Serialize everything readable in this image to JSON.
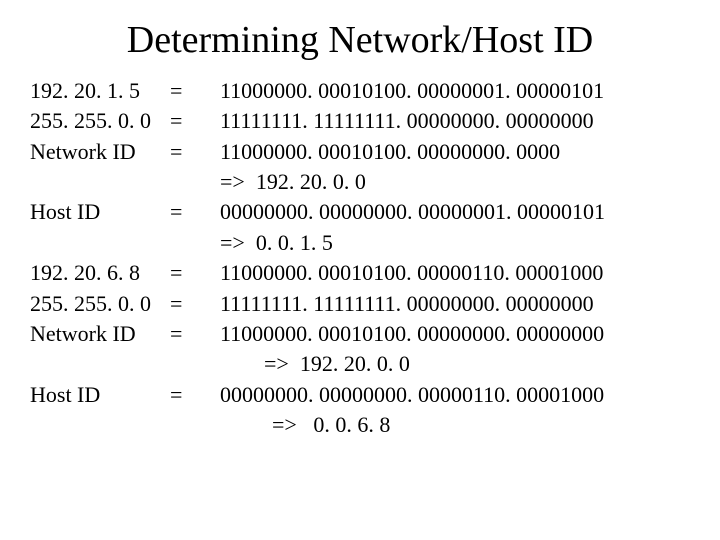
{
  "title": "Determining Network/Host ID",
  "eq": "=",
  "arrow": "=>",
  "ex1": {
    "ip_label": "192. 20. 1. 5",
    "ip_bin": "11000000. 00010100. 00000001. 00000101",
    "mask_label": "255. 255. 0. 0",
    "mask_bin": "11111111. 11111111. 00000000. 00000000",
    "net_label": "Network ID",
    "net_bin": "11000000. 00010100. 00000000. 0000",
    "net_result": "192. 20. 0. 0",
    "host_label": "Host ID",
    "host_bin": "00000000. 00000000. 00000001. 00000101",
    "host_result": "0. 0. 1. 5"
  },
  "ex2": {
    "ip_label": "192. 20. 6. 8",
    "ip_bin": "11000000. 00010100. 00000110. 00001000",
    "mask_label": "255. 255. 0. 0",
    "mask_bin": "11111111. 11111111. 00000000. 00000000",
    "net_label": "Network ID",
    "net_bin": "11000000. 00010100. 00000000. 00000000",
    "net_result": "192. 20. 0. 0",
    "host_label": "Host ID",
    "host_bin": "00000000. 00000000. 00000110. 00001000",
    "host_result": "0. 0. 6. 8"
  }
}
